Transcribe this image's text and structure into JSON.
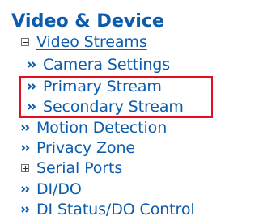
{
  "section_title": "Video & Device",
  "menu": {
    "video_streams": {
      "label": "Video Streams",
      "icon": "collapse-minus-icon"
    },
    "camera_settings": {
      "label": "Camera Settings",
      "icon": "double-arrow-icon"
    },
    "primary_stream": {
      "label": "Primary Stream",
      "icon": "double-arrow-icon"
    },
    "secondary_stream": {
      "label": "Secondary Stream",
      "icon": "double-arrow-icon"
    },
    "motion_detection": {
      "label": "Motion Detection",
      "icon": "double-arrow-icon"
    },
    "privacy_zone": {
      "label": "Privacy Zone",
      "icon": "double-arrow-icon"
    },
    "serial_ports": {
      "label": "Serial Ports",
      "icon": "expand-plus-icon"
    },
    "di_do": {
      "label": "DI/DO",
      "icon": "double-arrow-icon"
    },
    "di_status_do_control": {
      "label": "DI Status/DO Control",
      "icon": "double-arrow-icon"
    }
  },
  "colors": {
    "link": "#0b5cad",
    "highlight_border": "#e2101e"
  }
}
